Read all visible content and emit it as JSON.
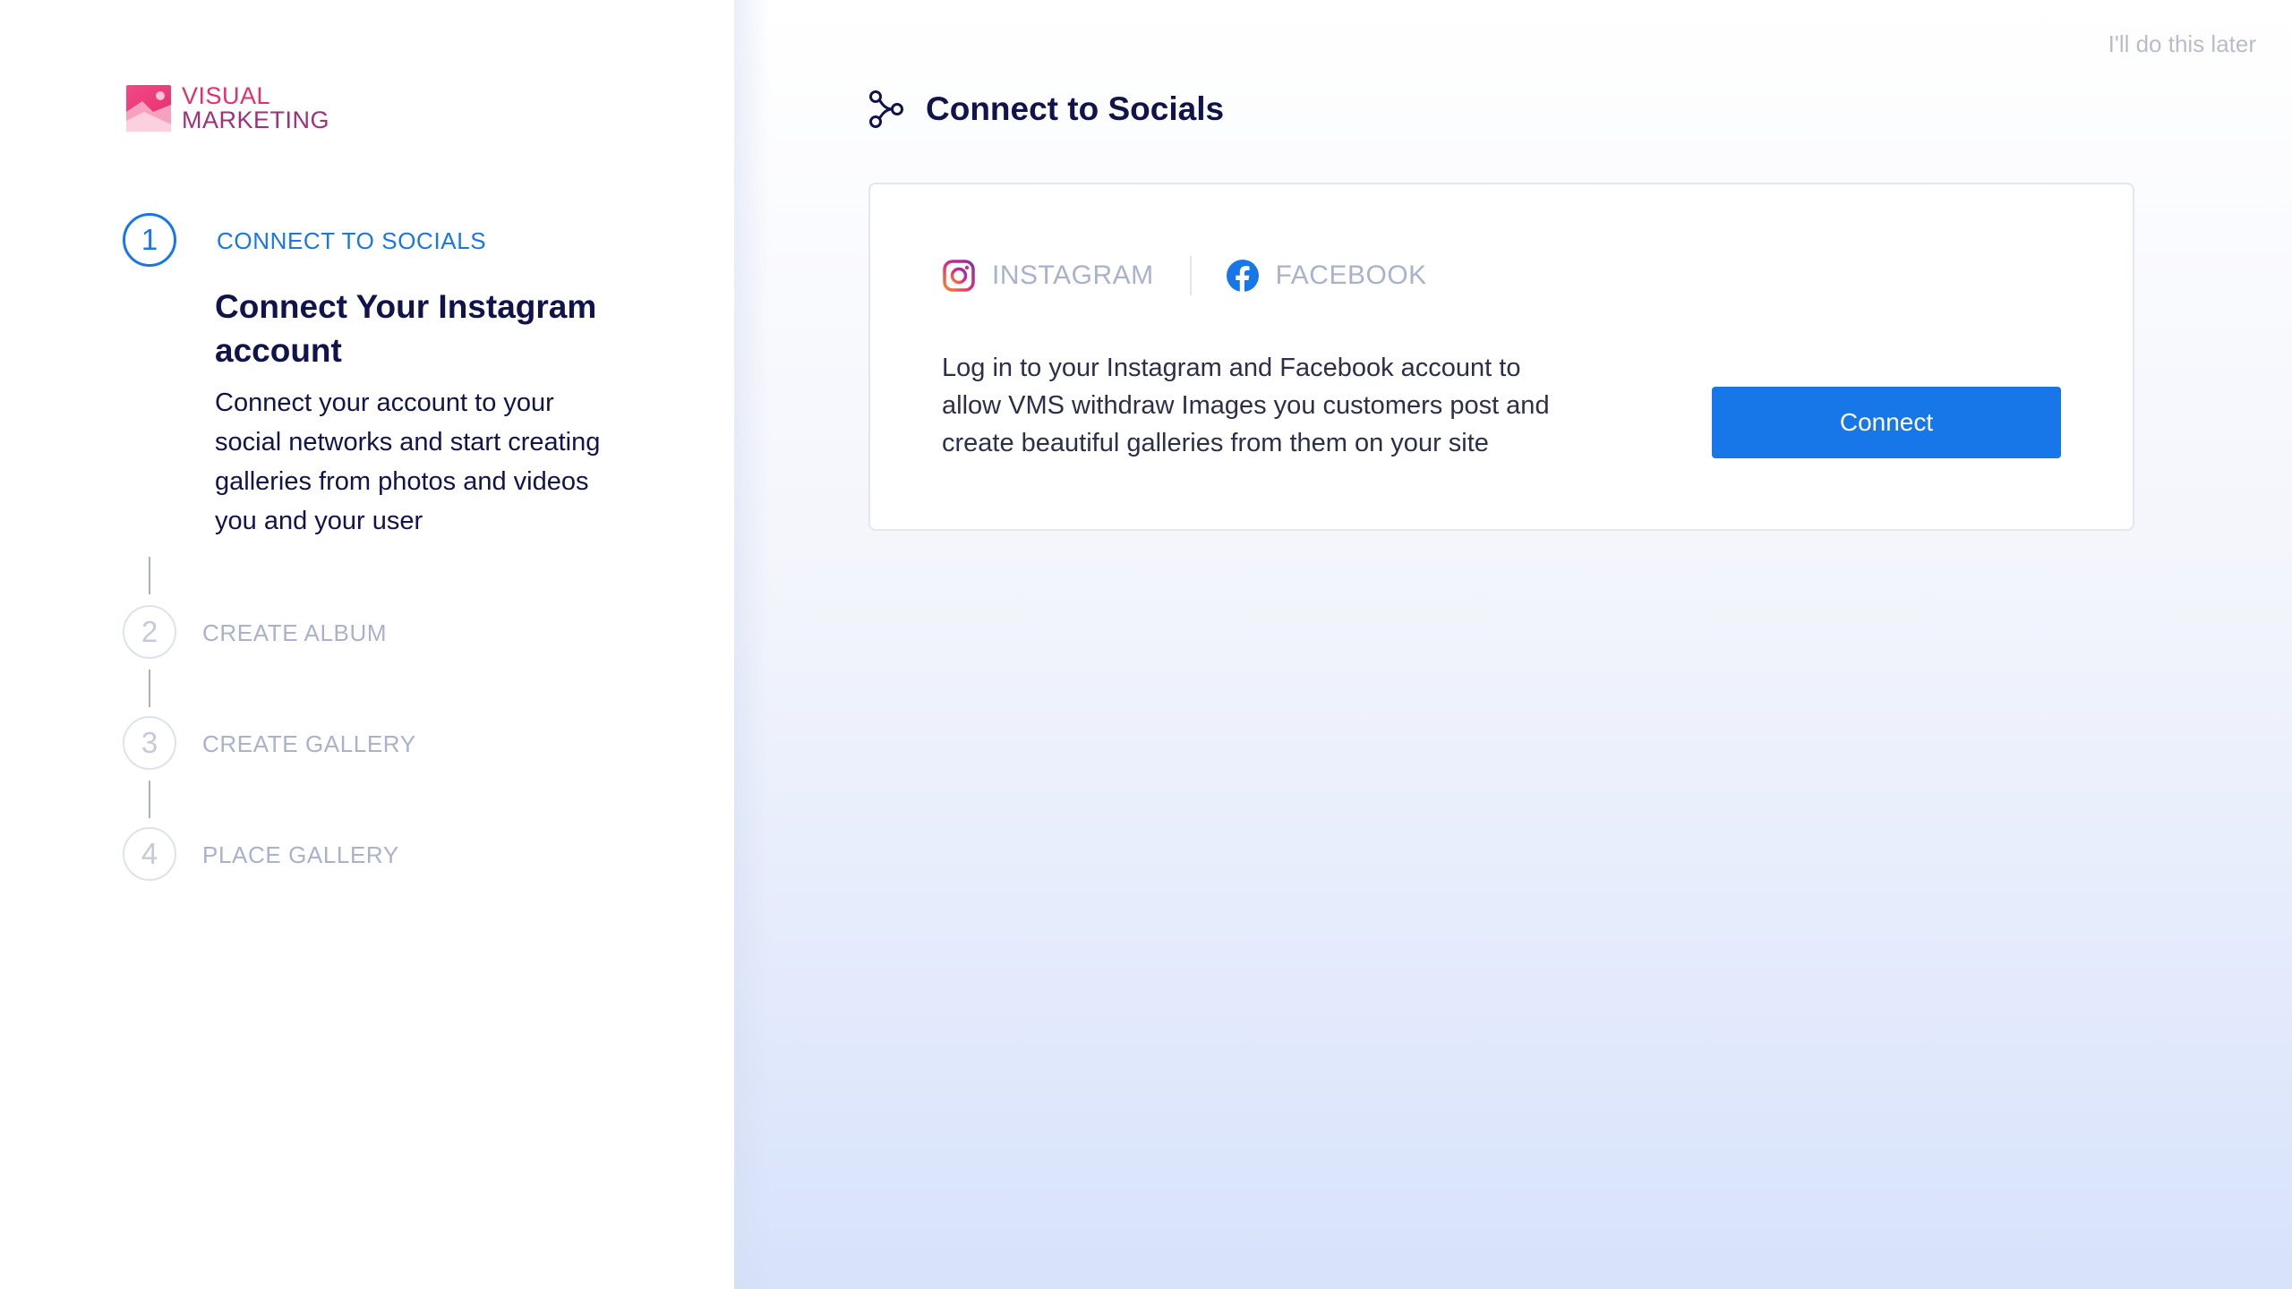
{
  "brand": {
    "line1": "VISUAL",
    "line2": "MARKETING"
  },
  "steps": [
    {
      "number": "1",
      "label": "CONNECT TO SOCIALS",
      "active": true
    },
    {
      "number": "2",
      "label": "CREATE ALBUM",
      "active": false
    },
    {
      "number": "3",
      "label": "CREATE GALLERY",
      "active": false
    },
    {
      "number": "4",
      "label": "PLACE GALLERY",
      "active": false
    }
  ],
  "active_step": {
    "title": "Connect Your Instagram account",
    "description": "Connect your account to your social networks and start creating galleries from photos and videos you and your user"
  },
  "header": {
    "skip_label": "I'll do this later",
    "title": "Connect to Socials",
    "icon": "share-nodes-icon"
  },
  "card": {
    "tabs": [
      {
        "label": "INSTAGRAM",
        "icon": "instagram-icon"
      },
      {
        "label": "FACEBOOK",
        "icon": "facebook-icon"
      }
    ],
    "description": "Log in to your Instagram and Facebook account to allow VMS withdraw Images you customers post and create beautiful galleries from them on your site",
    "button_label": "Connect"
  },
  "colors": {
    "accent": "#1877e8",
    "navy": "#10144a",
    "muted": "#a9b2cc",
    "brand_pink": "#e1306c"
  }
}
